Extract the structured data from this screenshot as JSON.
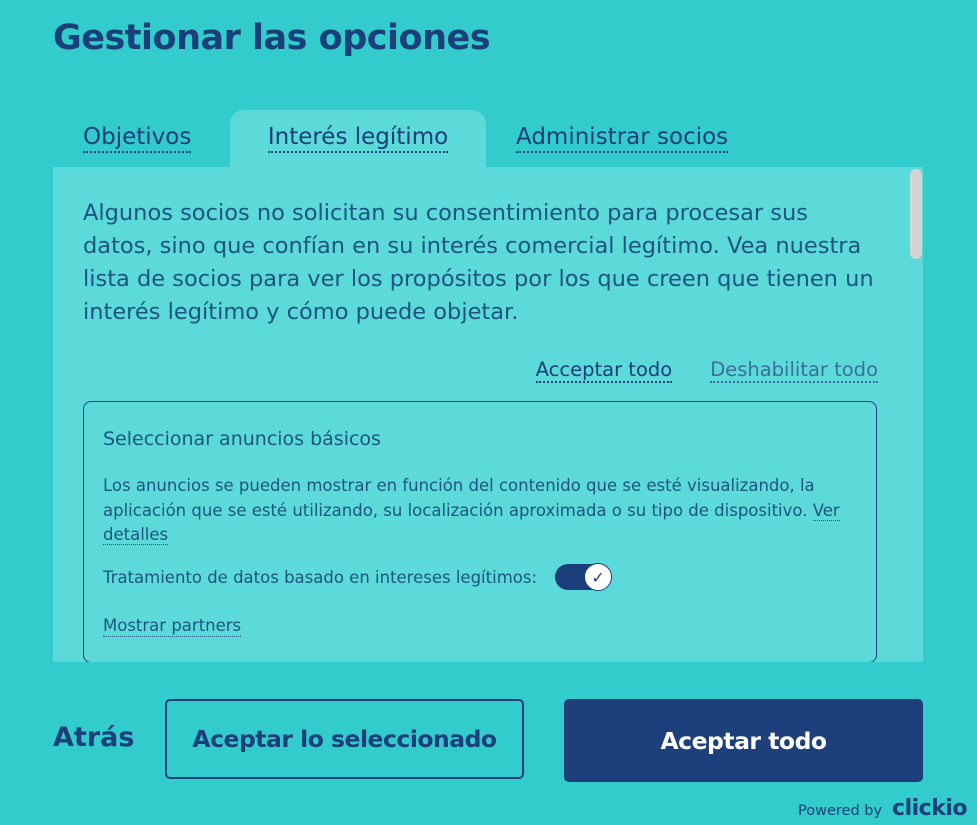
{
  "title": "Gestionar las opciones",
  "tabs": [
    {
      "label": "Objetivos",
      "active": false
    },
    {
      "label": "Interés legítimo",
      "active": true
    },
    {
      "label": "Administrar socios",
      "active": false
    }
  ],
  "panel": {
    "intro": "Algunos socios no solicitan su consentimiento para procesar sus datos, sino que confían en su interés comercial legítimo. Vea nuestra lista de socios para ver los propósitos por los que creen que tienen un interés legítimo y cómo puede objetar.",
    "accept_all_link": "Acceptar todo",
    "disable_all_link": "Deshabilitar todo",
    "card": {
      "title": "Seleccionar anuncios básicos",
      "description": "Los anuncios se pueden mostrar en función del contenido que se esté visualizando, la aplicación que se esté utilizando, su localización aproximada o su tipo de dispositivo.",
      "details_link": "Ver detalles",
      "legit_interest_label": "Tratamiento de datos basado en intereses legítimos:",
      "toggle_on": true,
      "toggle_glyph": "✓",
      "show_partners": "Mostrar partners"
    }
  },
  "footer": {
    "back": "Atrás",
    "accept_selected": "Aceptar lo seleccionado",
    "accept_all": "Aceptar todo",
    "powered_by": "Powered by",
    "brand": "clickio"
  },
  "colors": {
    "background": "#33cccc",
    "panel": "#5cd9d9",
    "primary": "#1d3f7c"
  }
}
